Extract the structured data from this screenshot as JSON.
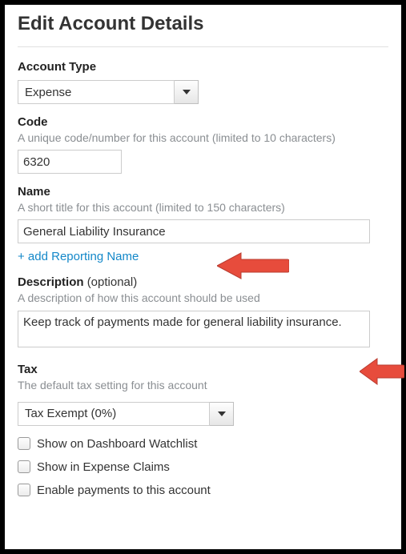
{
  "title": "Edit Account Details",
  "accountType": {
    "label": "Account Type",
    "value": "Expense"
  },
  "code": {
    "label": "Code",
    "help": "A unique code/number for this account (limited to 10 characters)",
    "value": "6320"
  },
  "name": {
    "label": "Name",
    "help": "A short title for this account (limited to 150 characters)",
    "value": "General Liability Insurance"
  },
  "reportingLink": "+ add Reporting Name",
  "description": {
    "label": "Description",
    "optional": "(optional)",
    "help": "A description of how this account should be used",
    "value": "Keep track of payments made for general liability insurance."
  },
  "tax": {
    "label": "Tax",
    "help": "The default tax setting for this account",
    "value": "Tax Exempt (0%)"
  },
  "checkboxes": {
    "dashboard": "Show on Dashboard Watchlist",
    "expenseClaims": "Show in Expense Claims",
    "enablePayments": "Enable payments to this account"
  },
  "annotations": {
    "arrowColor": "#e74c3c"
  }
}
